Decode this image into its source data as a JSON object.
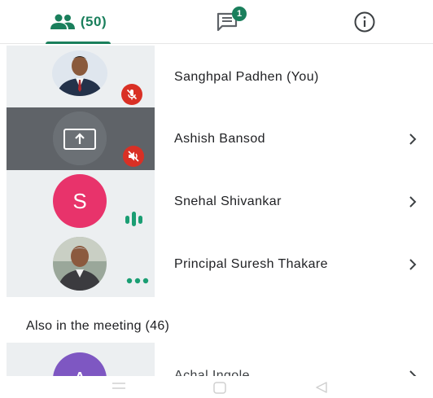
{
  "tabs": {
    "people_count": "(50)",
    "chat_badge": "1"
  },
  "participants": [
    {
      "name": "Sanghpal Padhen (You)",
      "avatar": "photo"
    },
    {
      "name": "Ashish Bansod",
      "avatar": "presenting"
    },
    {
      "name": "Snehal Shivankar",
      "avatar": "letter",
      "letter": "S",
      "color": "#e8336b"
    },
    {
      "name": "Principal Suresh Thakare",
      "avatar": "photo"
    }
  ],
  "section": {
    "title": "Also in the meeting (46)"
  },
  "others": [
    {
      "name": "Achal Ingole",
      "avatar": "letter",
      "letter": "A",
      "color": "#7e57c2"
    }
  ],
  "colors": {
    "accent": "#1a7f5c",
    "muted_badge": "#d93025",
    "row_bg": "#eceff1",
    "presenting_bg": "#5f6368"
  }
}
